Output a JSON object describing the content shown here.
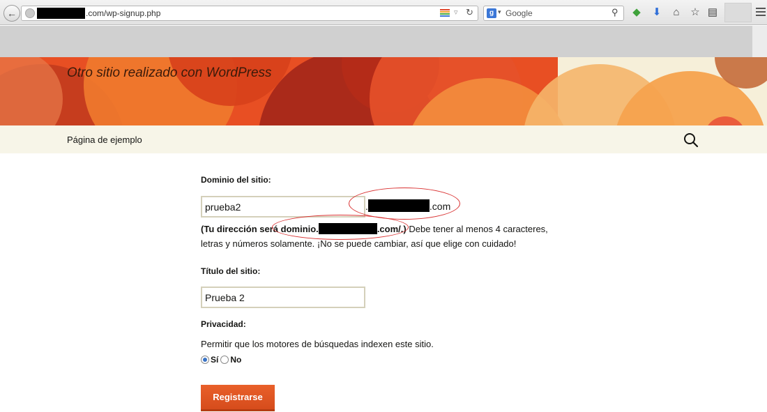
{
  "browser": {
    "url_suffix": ".com/wp-signup.php",
    "search_placeholder": "Google",
    "search_engine_letter": "g"
  },
  "site": {
    "description": "Otro sitio realizado con WordPress"
  },
  "nav": {
    "items": [
      {
        "label": "Página de ejemplo"
      }
    ]
  },
  "form": {
    "domain_label": "Dominio del sitio:",
    "domain_value": "prueba2",
    "domain_suffix_tld": ".com",
    "hint_bold_prefix": "Tu dirección será dominio.",
    "hint_bold_suffix": ".com/.",
    "hint_text": "Debe tener al menos 4 caracteres, letras y números solamente. ¡No se puede cambiar, así que elige con cuidado!",
    "title_label": "Título del sitio:",
    "title_value": "Prueba 2",
    "privacy_label": "Privacidad:",
    "privacy_text": "Permitir que los motores de búsquedas indexen este sitio.",
    "privacy_yes": "Sí",
    "privacy_no": "No",
    "privacy_selected": "yes",
    "submit_label": "Registrarse"
  },
  "colors": {
    "accent": "#e05d22",
    "header": "#e8542a",
    "nav_bg": "#f7f5e8",
    "annotation": "#d93030"
  }
}
